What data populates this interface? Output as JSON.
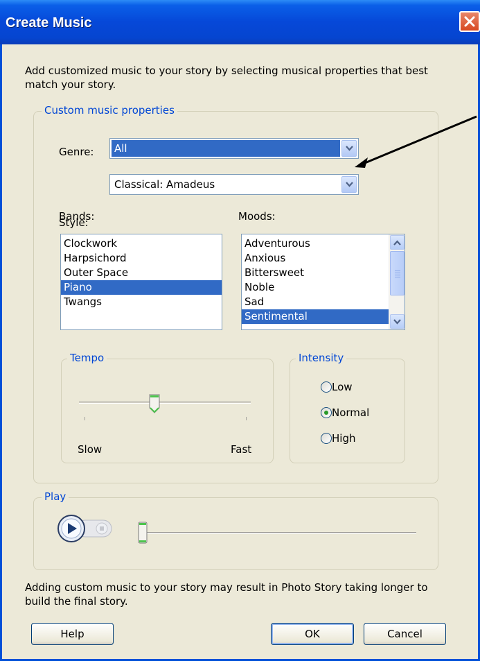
{
  "window": {
    "title": "Create Music"
  },
  "intro_text": "Add customized music to your story by selecting musical properties that best match your story.",
  "custom_group": {
    "title": "Custom music properties",
    "genre": {
      "label": "Genre:",
      "value": "All"
    },
    "style": {
      "label": "Style:",
      "value": "Classical: Amadeus"
    },
    "bands": {
      "label": "Bands:",
      "items": [
        "Clockwork",
        "Harpsichord",
        "Outer Space",
        "Piano",
        "Twangs"
      ],
      "selected": "Piano"
    },
    "moods": {
      "label": "Moods:",
      "items": [
        "Adventurous",
        "Anxious",
        "Bittersweet",
        "Noble",
        "Sad",
        "Sentimental"
      ],
      "selected": "Sentimental"
    }
  },
  "tempo": {
    "title": "Tempo",
    "slow_label": "Slow",
    "fast_label": "Fast",
    "level_fraction": 0.44
  },
  "intensity": {
    "title": "Intensity",
    "options": [
      "Low",
      "Normal",
      "High"
    ],
    "selected": "Normal"
  },
  "play": {
    "title": "Play",
    "position_fraction": 0.0
  },
  "footer_note": "Adding custom music to your story may result in Photo Story taking longer to build the final story.",
  "buttons": {
    "help": "Help",
    "ok": "OK",
    "cancel": "Cancel"
  },
  "colors": {
    "title_bar": "#0648d8",
    "selection": "#316ac5",
    "group_title": "#0046d5",
    "close_button": "#d84820"
  },
  "annotation": {
    "arrow_color": "#000000"
  }
}
